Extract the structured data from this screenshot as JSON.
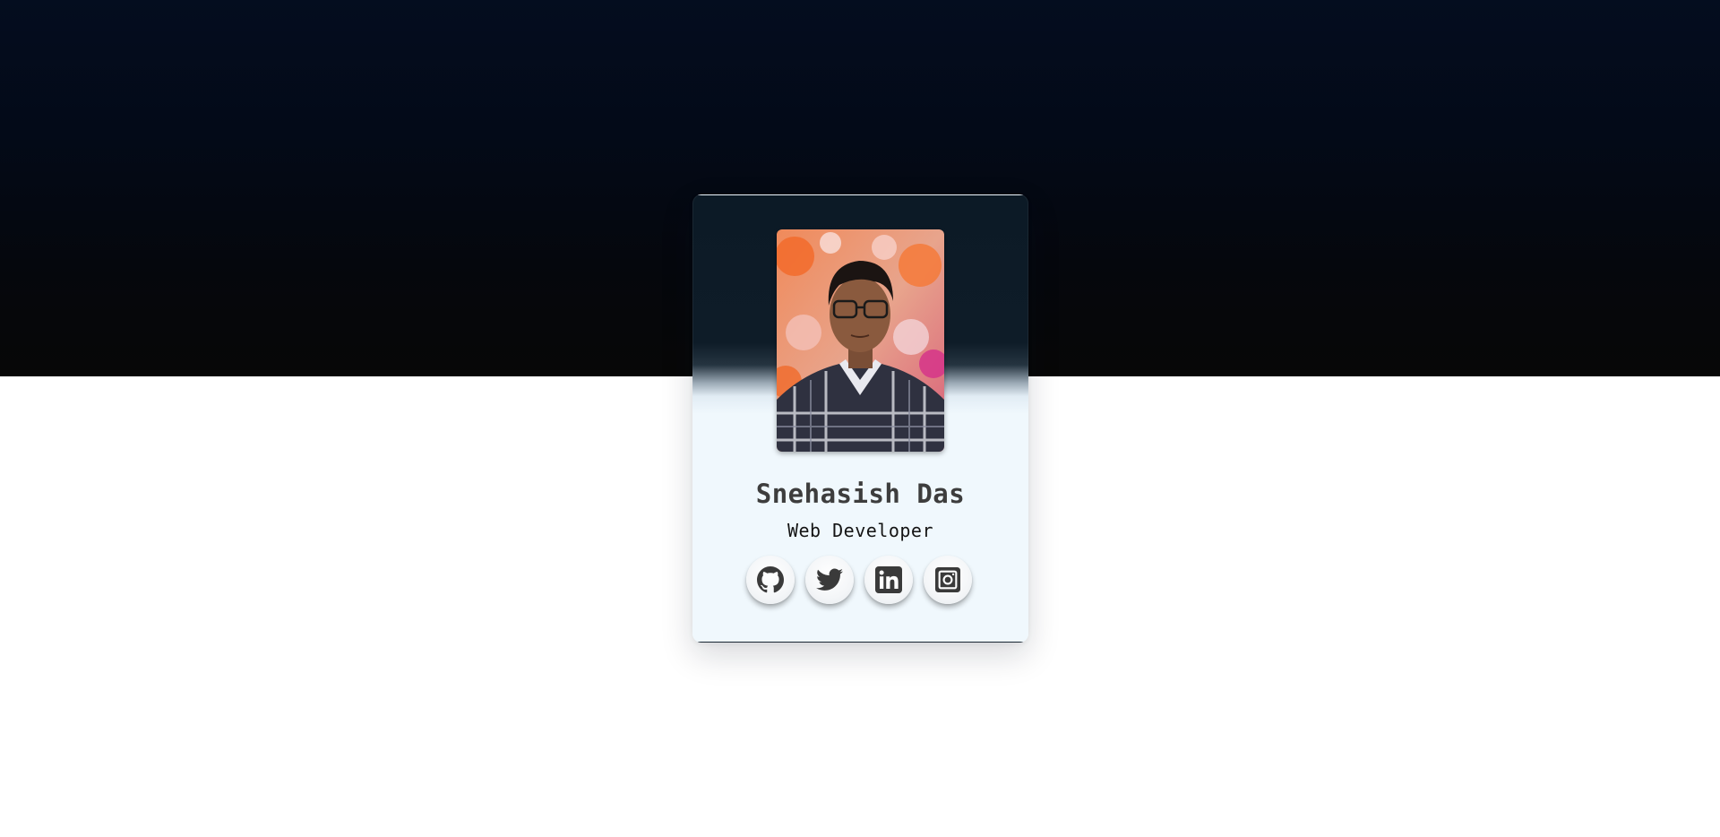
{
  "profile": {
    "name": "Snehasish Das",
    "role": "Web Developer",
    "avatar_alt": "Profile photo"
  },
  "socials": [
    {
      "label": "GitHub",
      "icon": "github-icon"
    },
    {
      "label": "Twitter",
      "icon": "twitter-icon"
    },
    {
      "label": "LinkedIn",
      "icon": "linkedin-icon"
    },
    {
      "label": "Instagram",
      "icon": "instagram-icon"
    }
  ],
  "colors": {
    "background_top": "#040d1f",
    "background_bottom": "#ffffff",
    "card_top": "#0c1a26",
    "card_bottom": "#f0f8fd",
    "name_text": "#3d3d3d",
    "icon": "#3a3a3a"
  }
}
